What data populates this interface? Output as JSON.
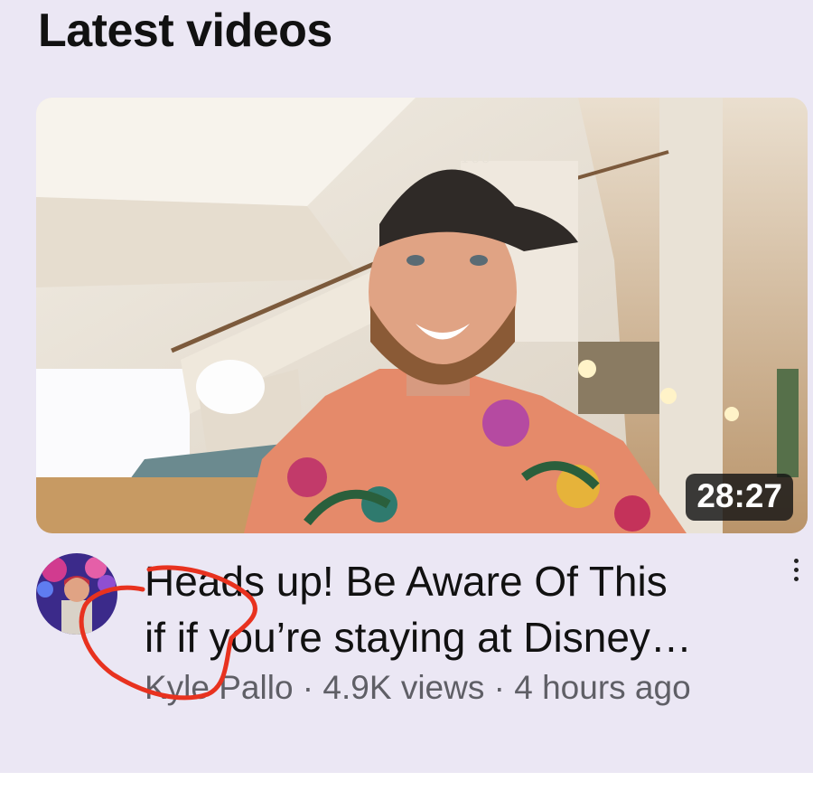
{
  "section": {
    "title": "Latest videos"
  },
  "video": {
    "duration": "28:27",
    "title_line1": "Heads up! Be Aware Of This",
    "title_line2": "if if you’re staying at Disney…",
    "channel": "Kyle Pallo",
    "views": "4.9K views",
    "age": "4 hours ago",
    "separator": " · "
  },
  "icons": {
    "more": "more-vert-icon",
    "annotation": "red-circle-annotation"
  },
  "colors": {
    "panel_bg": "#ebe7f4",
    "annotation": "#e8321f",
    "duration_bg": "#141414"
  }
}
